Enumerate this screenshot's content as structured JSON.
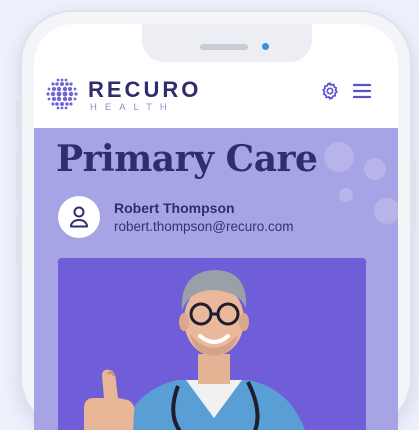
{
  "brand": {
    "name": "RECURO",
    "sub": "HEALTH",
    "primary_color": "#2f2d6e",
    "accent_color": "#a6a4e4"
  },
  "header": {
    "settings_icon": "gear-icon",
    "menu_icon": "hamburger-menu-icon"
  },
  "page": {
    "title": "Primary Care"
  },
  "user": {
    "name": "Robert Thompson",
    "email": "robert.thompson@recuro.com",
    "avatar_icon": "user-icon"
  },
  "photo": {
    "description_icon": "doctor-thumbs-up-photo",
    "background": "#6f5ed8"
  }
}
